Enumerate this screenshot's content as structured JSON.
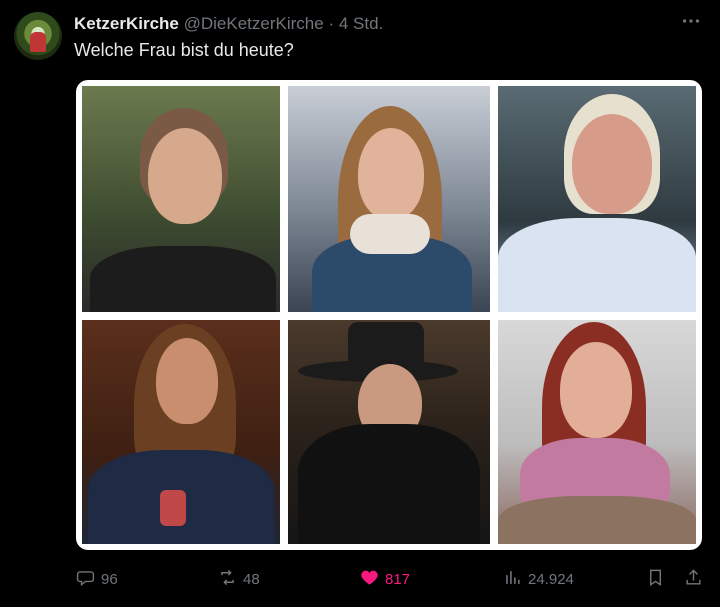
{
  "tweet": {
    "author_name": "KetzerKirche",
    "handle": "@DieKetzerKirche",
    "separator": "·",
    "time": "4 Std.",
    "text": "Welche Frau bist du heute?"
  },
  "actions": {
    "replies": "96",
    "retweets": "48",
    "likes": "817",
    "views": "24.924"
  },
  "colors": {
    "like_active": "#f91880",
    "muted": "#71767b",
    "text": "#e7e9ea"
  },
  "icons": [
    "more-icon",
    "reply-icon",
    "retweet-icon",
    "like-icon",
    "views-icon",
    "bookmark-icon",
    "share-icon"
  ]
}
